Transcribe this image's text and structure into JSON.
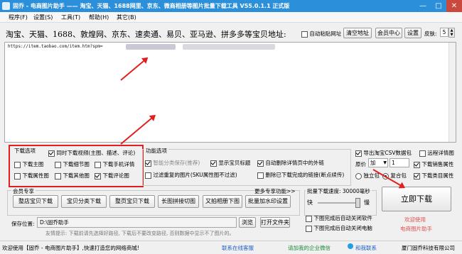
{
  "title": {
    "text": "固乔 - 电商图片助手 —— 淘宝、天猫、1688网里、京东、微商相册等图片批量下载工具 V55.0.1.1 正式版"
  },
  "window_controls": {
    "minimize": "—",
    "maximize": "□",
    "close": "✕"
  },
  "menu": [
    "程序(F)",
    "设置(S)",
    "工具(T)",
    "帮助(H)",
    "其它(B)"
  ],
  "sites_line": "淘宝、天猫、1688、敦煌网、京东、速卖通、易贝、亚马逊、拼多多等宝贝地址:",
  "top_controls": {
    "auto_paste": "自动粘贴网址",
    "clear_url": "清空地址",
    "member_center": "会员中心",
    "settings": "设置",
    "skin_label": "皮肤:",
    "skin_value": "5"
  },
  "url_text": "https://item.taobao.com/item.htm?spm=",
  "download_options": {
    "title": "下载选项",
    "items": [
      {
        "label": "同时下载视频(主图、描述、评论)",
        "checked": true
      },
      {
        "label": "下载主图",
        "checked": false
      },
      {
        "label": "下载细节图",
        "checked": false
      },
      {
        "label": "下载手机详情",
        "checked": false
      },
      {
        "label": "下载属性图",
        "checked": false
      },
      {
        "label": "下载其他图",
        "checked": false
      },
      {
        "label": "下载评论图",
        "checked": true
      }
    ]
  },
  "function_options": {
    "title": "功能选项",
    "items": [
      {
        "label": "智能分类保存(推荐)",
        "checked": true
      },
      {
        "label": "显示宝贝标题",
        "checked": true
      },
      {
        "label": "自动删除详情页中的外链",
        "checked": true
      },
      {
        "label": "过滤重复的图片(SKU属性图不过滤)",
        "checked": false
      },
      {
        "label": "删除已下载完成的链接(断点续传)",
        "checked": false
      }
    ]
  },
  "right_options": {
    "export_csv": {
      "label": "导出淘宝CSV数据包",
      "checked": true
    },
    "original_price_label": "原价",
    "price_op": "加",
    "price_value": "1",
    "download_sales_attr": {
      "label": "下载销售属性",
      "checked": true
    },
    "standalone_pkg": "独立包",
    "merged_pkg": "复合包",
    "download_type_attr": {
      "label": "下载类目属性",
      "checked": true
    },
    "detail_details": {
      "label": "远程详情图",
      "checked": false
    }
  },
  "member_exclusive": {
    "title": "会员专享",
    "buttons": [
      "整店宝贝下载",
      "宝贝分类下载",
      "整页宝贝下载",
      "长图拼接切图",
      "又拍相册下图"
    ],
    "more_link": "更多专享功能>>",
    "batch_print": "批量加水印设置"
  },
  "speed": {
    "title": "批量下载速度: 30000毫秒",
    "fast": "快",
    "slow": "慢"
  },
  "download_button": "立即下载",
  "welcome": {
    "line1": "欢迎使用",
    "line2": "电商图片助手"
  },
  "save_path": {
    "label": "保存位置:",
    "value": "D:\\固乔助手",
    "browse": "浏览",
    "open_folder": "打开文件夹"
  },
  "after_done": {
    "shutdown": "下图完成后自动关闭软件",
    "poweroff": "下图完成后自动关闭电脑"
  },
  "tip": "友情提示: 下载前请先选择好路径, 下载后不要改变路径, 否则数据中显示不了图片的。",
  "statusbar": {
    "left": "欢迎使用【固乔 - 电商图片助手】,快速打造您的网络商城!",
    "service": "联系在线客服",
    "wechat": "请加我的企业微信",
    "qq": "和我联系",
    "company": "厦门固乔科技有限公司"
  }
}
